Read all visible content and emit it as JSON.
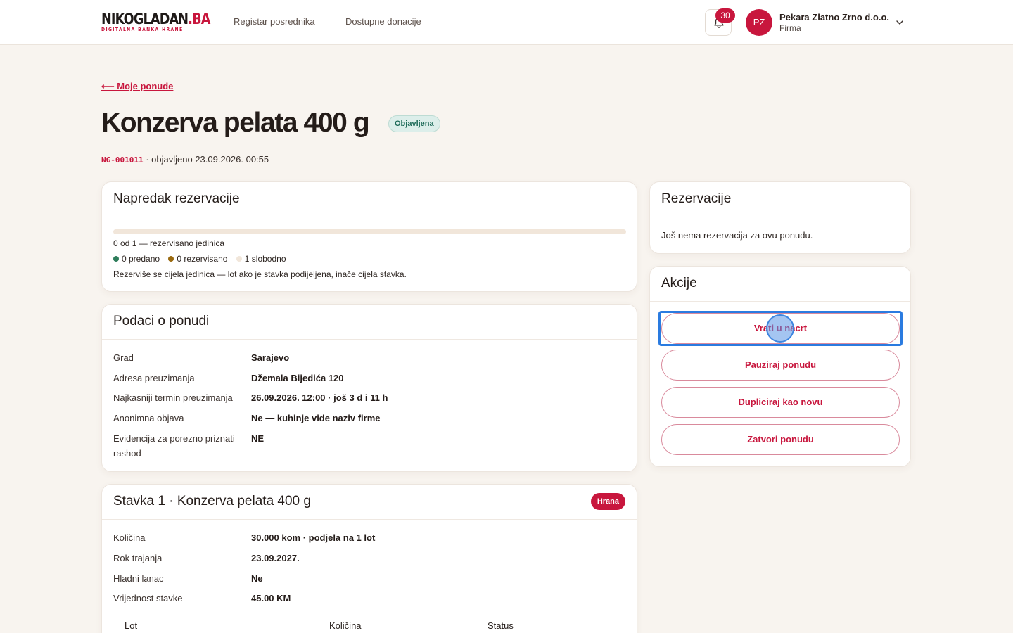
{
  "header": {
    "logo_main_dark": "NIKOGLADAN",
    "logo_main_red": ".BA",
    "logo_sub": "DIGITALNA BANKA HRANE",
    "nav": [
      "Registar posrednika",
      "Dostupne donacije"
    ],
    "notifications_count": "30",
    "avatar_initials": "PZ",
    "org_name": "Pekara Zlatno Zrno d.o.o.",
    "org_type": "Firma"
  },
  "page": {
    "back_link": "⟵ Moje ponude",
    "title": "Konzerva pelata 400 g",
    "status": "Objavljena",
    "code": "NG-001011",
    "published": " · objavljeno 23.09.2026. 00:55"
  },
  "progress_card": {
    "title": "Napredak rezervacije",
    "reserved_fraction": 0,
    "summary": "0 od 1 — rezervisano jedinica",
    "legend": {
      "delivered": "0 predano",
      "reserved": "0 rezervisano",
      "free": "1 slobodno"
    },
    "note": "Rezerviše se cijela jedinica — lot ako je stavka podijeljena, inače cijela stavka."
  },
  "offer_card": {
    "title": "Podaci o ponudi",
    "rows": [
      {
        "label": "Grad",
        "value": "Sarajevo"
      },
      {
        "label": "Adresa preuzimanja",
        "value": "Džemala Bijedića 120"
      },
      {
        "label": "Najkasniji termin preuzimanja",
        "value": "26.09.2026. 12:00 · još 3 d i 11 h"
      },
      {
        "label": "Anonimna objava",
        "value": "Ne — kuhinje vide naziv firme"
      },
      {
        "label": "Evidencija za porezno priznati rashod",
        "value": "NE"
      }
    ]
  },
  "item_card": {
    "title": "Stavka 1 · Konzerva pelata 400 g",
    "category": "Hrana",
    "rows": [
      {
        "label": "Količina",
        "value": "30.000 kom · podjela na 1 lot"
      },
      {
        "label": "Rok trajanja",
        "value": "23.09.2027."
      },
      {
        "label": "Hladni lanac",
        "value": "Ne"
      },
      {
        "label": "Vrijednost stavke",
        "value": "45.00 KM"
      }
    ],
    "table_headers": [
      "Lot",
      "Količina",
      "Status"
    ]
  },
  "reservations_card": {
    "title": "Rezervacije",
    "empty": "Još nema rezervacija za ovu ponudu."
  },
  "actions_card": {
    "title": "Akcije",
    "buttons": [
      "Vrati u nacrt",
      "Pauziraj ponudu",
      "Dupliciraj kao novu",
      "Zatvori ponudu"
    ]
  },
  "colors": {
    "brand": "#c8163d",
    "delivered": "#2e7d5b",
    "reserved": "#9a6a10",
    "free": "#f1e6da",
    "focus": "#2a7be0"
  }
}
